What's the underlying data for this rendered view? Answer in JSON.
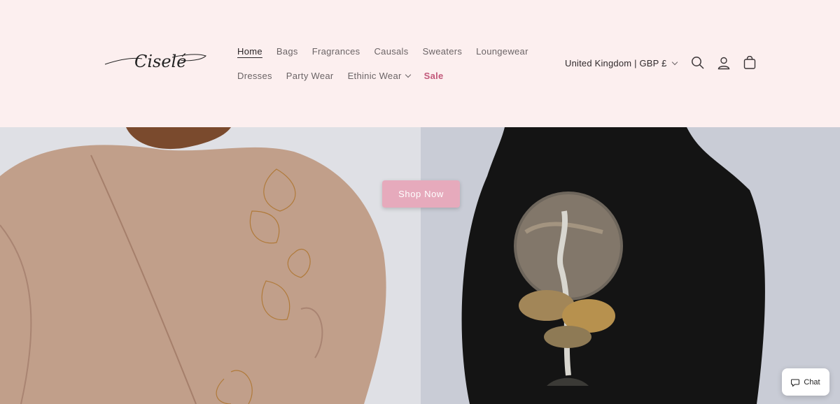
{
  "brand": {
    "logo_text": "Ciselé"
  },
  "nav": {
    "row1": [
      "Home",
      "Bags",
      "Fragrances",
      "Causals",
      "Sweaters",
      "Loungewear"
    ],
    "row2": [
      "Dresses",
      "Party Wear",
      "Ethinic Wear",
      "Sale"
    ]
  },
  "tools": {
    "country": "United Kingdom | GBP £",
    "search_icon": "search-icon",
    "account_icon": "account-icon",
    "cart_icon": "cart-icon"
  },
  "hero": {
    "button_label": "Shop Now"
  },
  "chat": {
    "label": "Chat"
  },
  "colors": {
    "header_bg": "#fcefef",
    "sale": "#c2587a",
    "cta": "#e6aabc"
  }
}
